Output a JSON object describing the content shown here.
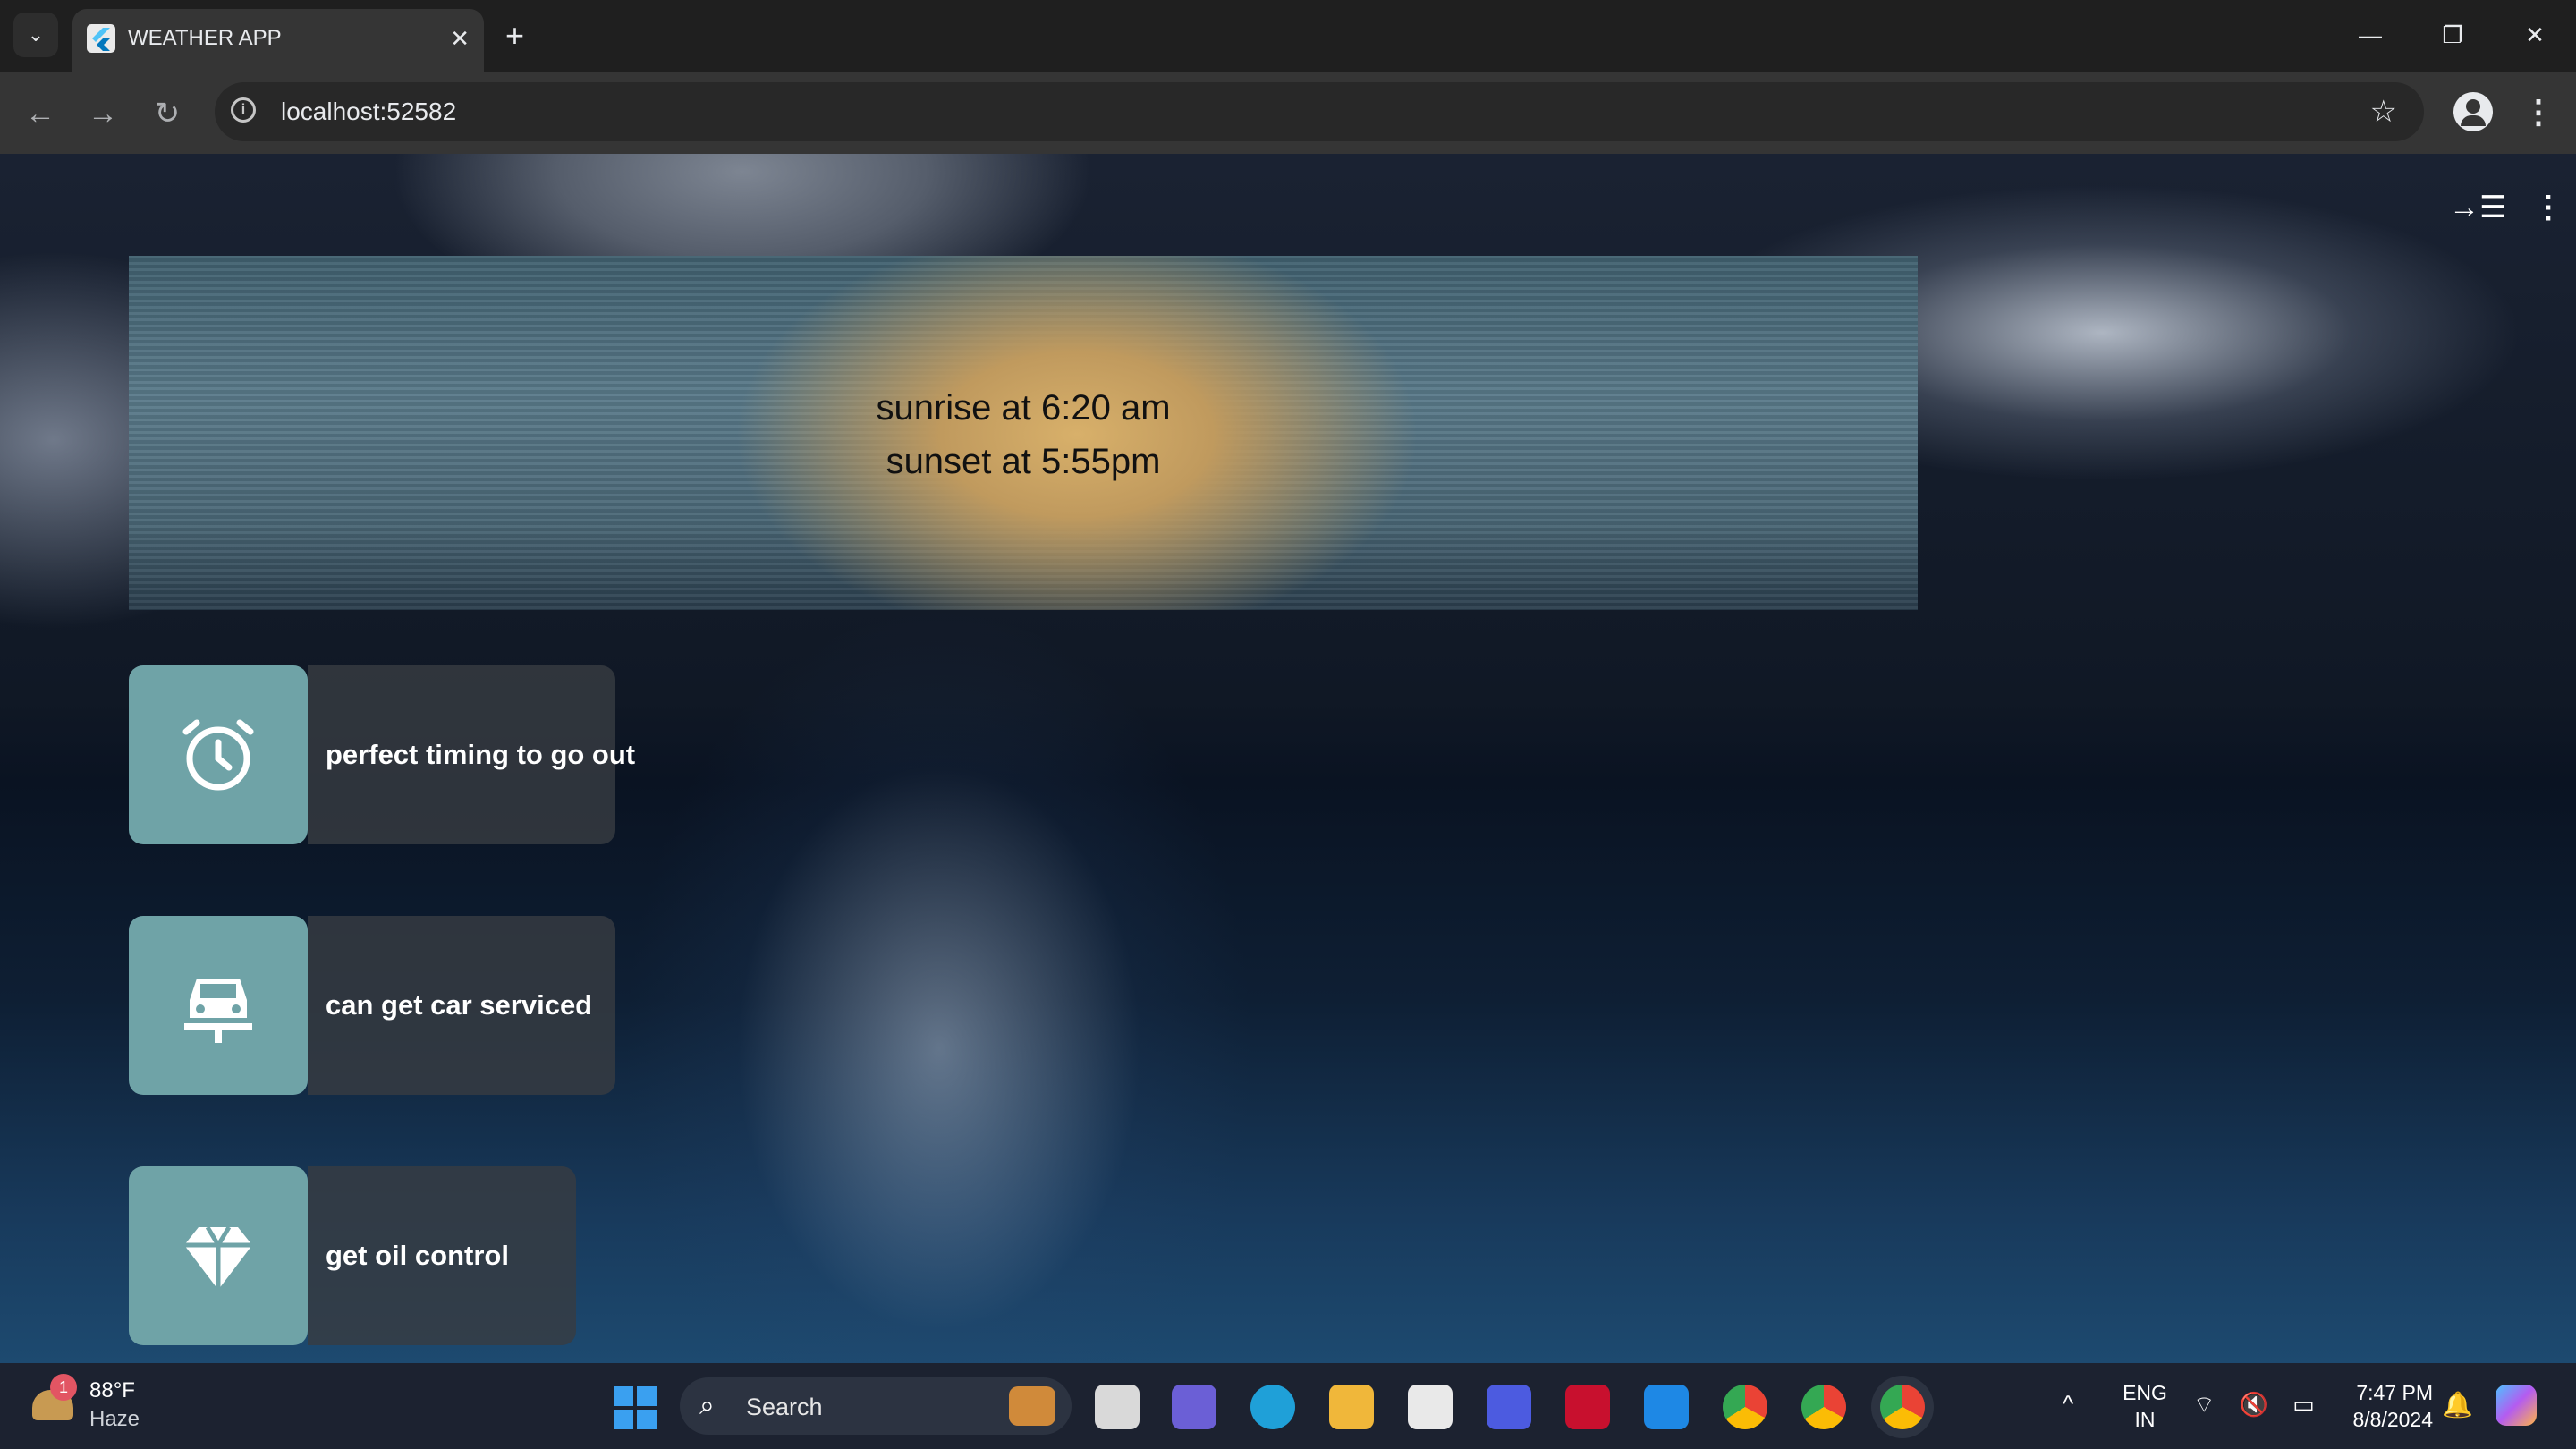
{
  "browser": {
    "tab_title": "WEATHER APP",
    "tab_close": "✕",
    "new_tab": "+",
    "url": "localhost:52582",
    "window_controls": {
      "minimize": "—",
      "restore": "❐",
      "close": "✕"
    },
    "nav": {
      "back": "←",
      "forward": "→",
      "reload": "↻"
    },
    "star": "☆",
    "menu": "⋮"
  },
  "page": {
    "top_icons": {
      "collapse": "→☰",
      "more": "⋮"
    },
    "sun_card": {
      "line1": "sunrise at 6:20 am",
      "line2": "sunset at 5:55pm"
    },
    "features": [
      {
        "icon": "alarm-clock-icon",
        "label": "perfect timing to go out"
      },
      {
        "icon": "car-service-icon",
        "label": "can get car serviced"
      },
      {
        "icon": "diamond-icon",
        "label": "get oil control"
      }
    ]
  },
  "taskbar": {
    "weather": {
      "badge": "1",
      "temp": "88°F",
      "condition": "Haze"
    },
    "search_label": "Search",
    "search_glass": "⌕",
    "tray_up": "^",
    "lang_line1": "ENG",
    "lang_line2": "IN",
    "tray_icons": "⌔ 🔇 ▭",
    "time": "7:47 PM",
    "date": "8/8/2024",
    "bell": "🔔"
  },
  "colors": {
    "feature_icon_bg": "#6fa3a7",
    "feature_panel_bg": "#373c42",
    "chrome_dark": "#1f1f1f",
    "chrome_toolbar": "#353535"
  }
}
